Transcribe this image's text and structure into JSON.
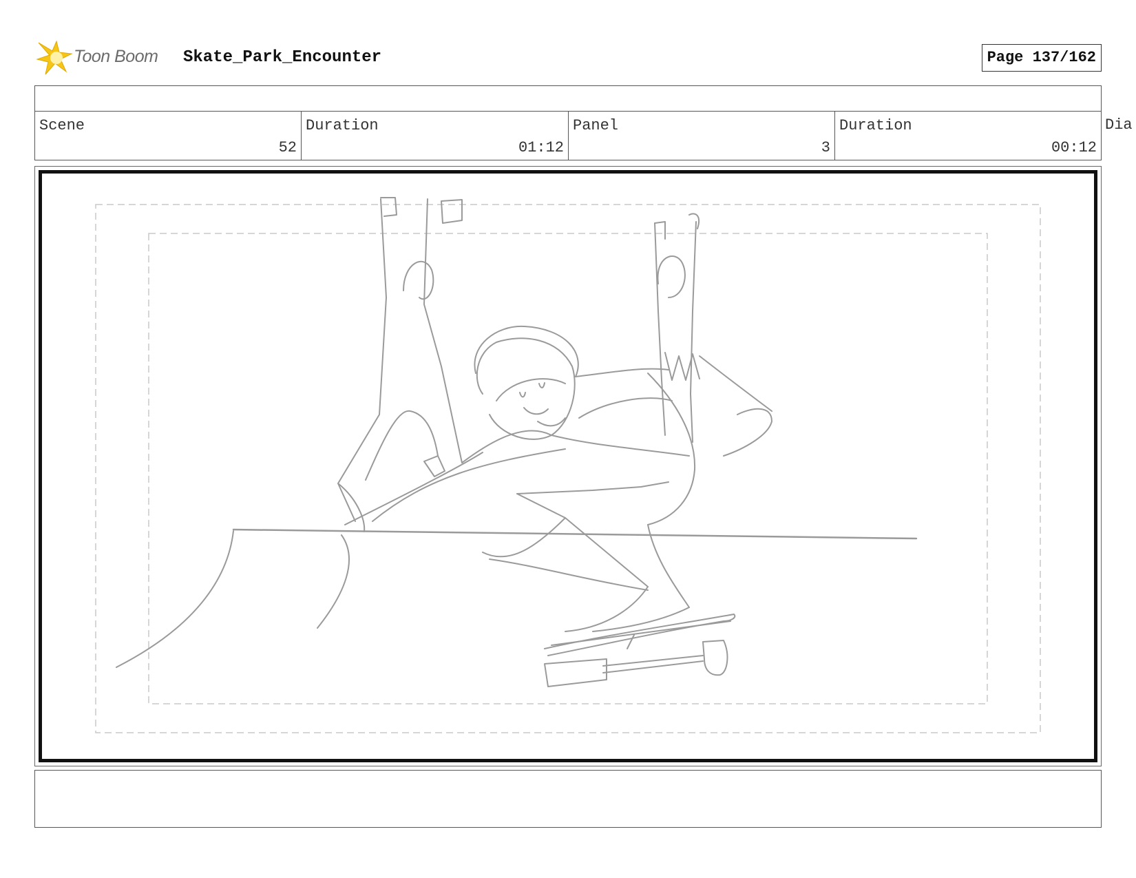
{
  "header": {
    "logo_text": "Toon Boom",
    "project_title": "Skate_Park_Encounter",
    "page_label": "Page 137/162"
  },
  "info": {
    "scene_label": "Scene",
    "scene_value": "52",
    "scene_duration_label": "Duration",
    "scene_duration_value": "01:12",
    "panel_label": "Panel",
    "panel_value": "3",
    "panel_duration_label": "Duration",
    "panel_duration_value": "00:12",
    "dialog_label": "Dia"
  },
  "colors": {
    "logo_star": "#f5c518",
    "sketch": "#9a9a9a",
    "safe_frame": "#c8c8c8"
  }
}
